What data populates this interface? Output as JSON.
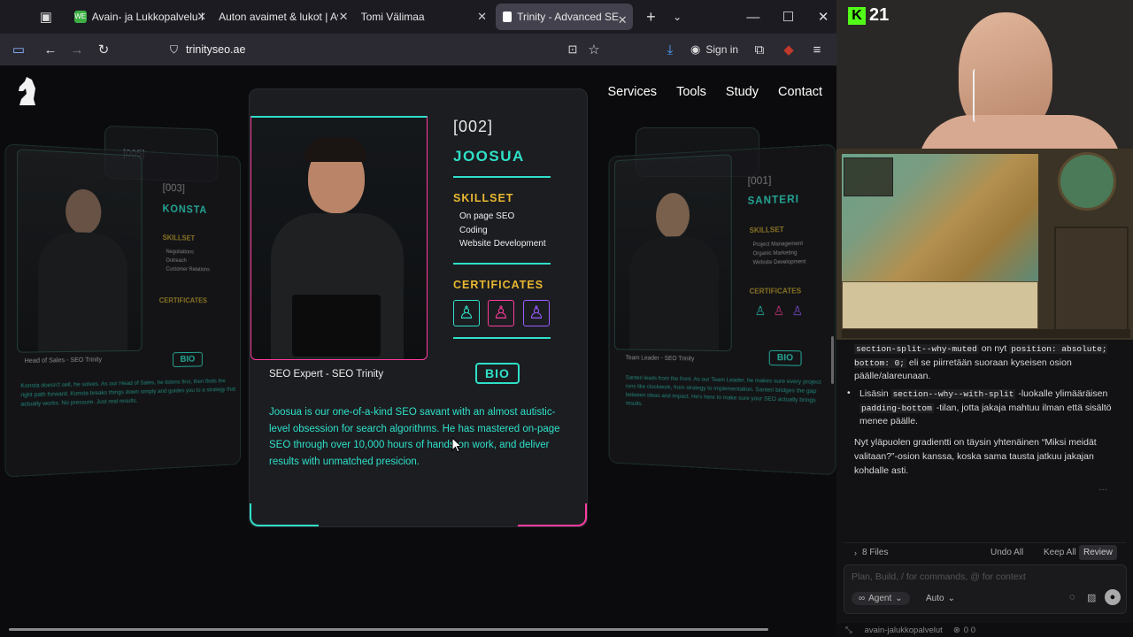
{
  "browser": {
    "tabs": [
      {
        "label": "Avain- ja Lukkopalvelu L",
        "favicon": "WE"
      },
      {
        "label": "Auton avaimet & lukot | Ava"
      },
      {
        "label": "Tomi Välimaa"
      },
      {
        "label": "Trinity - Advanced SEO S",
        "active": true
      }
    ],
    "url": "trinityseo.ae",
    "sign_in": "Sign in"
  },
  "site": {
    "nav": [
      "Services",
      "Tools",
      "Study",
      "Contact"
    ],
    "center_card": {
      "id": "[002]",
      "name": "JOOSUA",
      "skillset_title": "SKILLSET",
      "skills": [
        "On page SEO",
        "Coding",
        "Website Development"
      ],
      "certificates_title": "CERTIFICATES",
      "role": "SEO Expert - SEO Trinity",
      "bio_button": "BIO",
      "bio": "Joosua is our one-of-a-kind SEO savant with an almost autistic-level obsession for search algorithms. He has mastered on-page SEO through over 10,000 hours of hands-on work, and deliver results with unmatched presicion."
    },
    "left_card": {
      "id": "[003]",
      "back_id": "[005]",
      "name": "KONSTA",
      "skillset_title": "SKILLSET",
      "skills": [
        "Negotiations",
        "Outreach",
        "Customer Relations"
      ],
      "certificates_title": "CERTIFICATES",
      "role": "Head of Sales - SEO Trinity",
      "bio_button": "BIO",
      "bio": "Konsta doesn't sell, he solves. As our Head of Sales, he listens first, then finds the right path forward. Konsta breaks things down simply and guides you to a strategy that actually works. No pressure. Just real results."
    },
    "right_card": {
      "id": "[001]",
      "name": "SANTERI",
      "skillset_title": "SKILLSET",
      "skills": [
        "Project Management",
        "Organic Marketing",
        "Website Development"
      ],
      "certificates_title": "CERTIFICATES",
      "role": "Team Leader - SEO Trinity",
      "bio_button": "BIO",
      "bio": "Santeri leads from the front. As our Team Leader, he makes sure every project runs like clockwork, from strategy to implementation. Santeri bridges the gap between ideas and impact. He's here to make sure your SEO actually brings results."
    }
  },
  "stream": {
    "badge": "21"
  },
  "chat": {
    "line1_code": "section-split--why-muted",
    "line1_mid": " on nyt ",
    "line1_code2": "position: absolute; bottom: 0;",
    "line1_end": " eli se piirretään suoraan kyseisen osion päälle/alareunaan.",
    "bullet2_pre": "Lisäsin ",
    "bullet2_code": "section--why--with-split",
    "bullet2_mid": " -luokalle ylimääräisen ",
    "bullet2_code2": "padding-bottom",
    "bullet2_end": " -tilan, jotta jakaja mahtuu ilman että sisältö menee päälle.",
    "summary": "Nyt yläpuolen gradientti on täysin yhtenäinen “Miksi meidät valitaan?”-osion kanssa, koska sama tausta jatkuu jakajan kohdalle asti.",
    "files": "8 Files",
    "undo_all": "Undo All",
    "keep_all": "Keep All",
    "review": "Review",
    "input_placeholder": "Plan, Build, / for commands, @ for context",
    "agent": "Agent",
    "auto": "Auto",
    "status_branch": "avain-jalukkopalvelut",
    "status_counts": "0  0"
  },
  "colors": {
    "teal": "#2ee0c8",
    "pink": "#ff3c9e",
    "purple": "#9b5cff"
  }
}
